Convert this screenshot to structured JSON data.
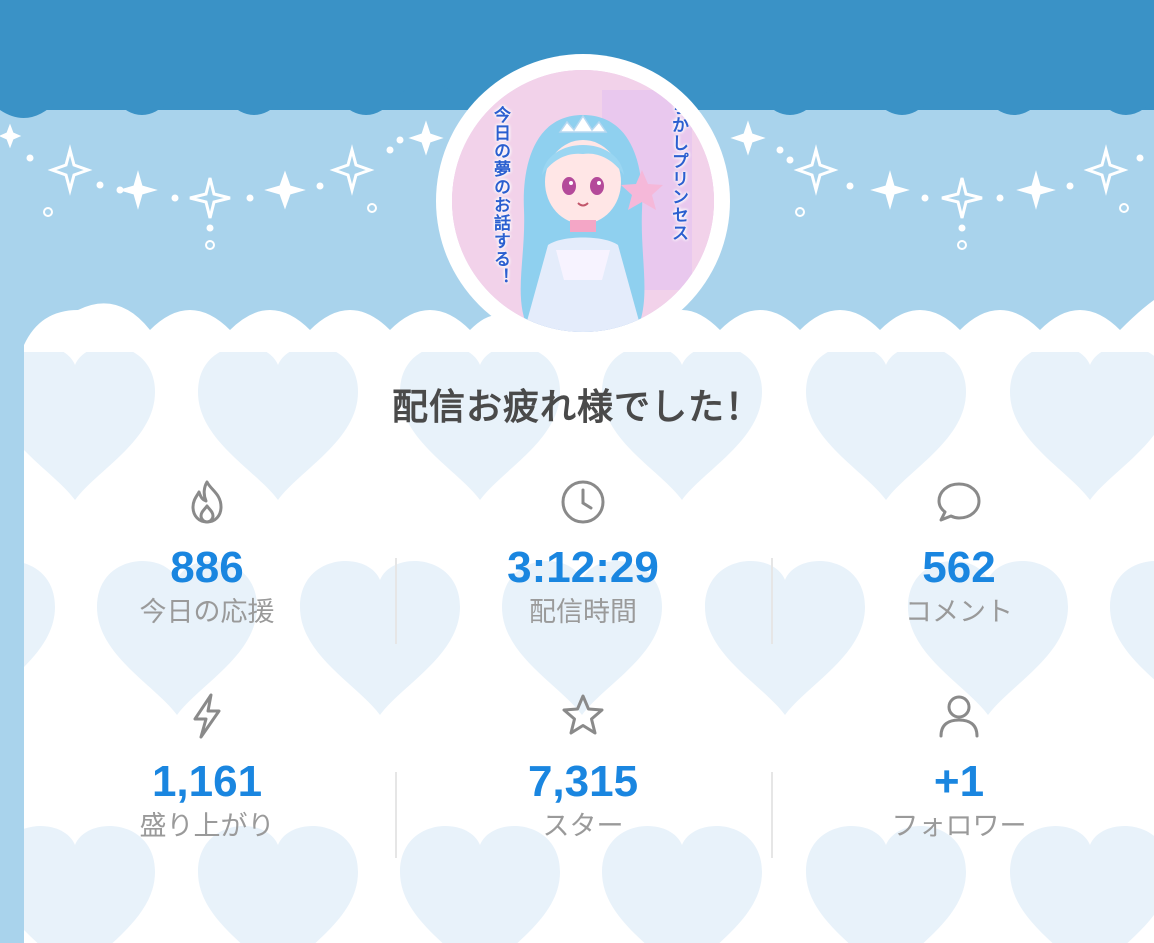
{
  "header": {
    "colors": {
      "top_band": "#3a92c6",
      "light_band": "#a9d3ec",
      "card": "#ffffff",
      "heart": "#e8f2fa"
    }
  },
  "avatar": {
    "text_right": "らかしプリンセス",
    "text_left": "今日の夢のお話する！"
  },
  "headline": "配信お疲れ様でした！",
  "stats": [
    {
      "icon": "flame-icon",
      "value": "886",
      "label": "今日の応援"
    },
    {
      "icon": "clock-icon",
      "value": "3:12:29",
      "label": "配信時間"
    },
    {
      "icon": "comment-icon",
      "value": "562",
      "label": "コメント"
    },
    {
      "icon": "lightning-icon",
      "value": "1,161",
      "label": "盛り上がり"
    },
    {
      "icon": "star-icon",
      "value": "7,315",
      "label": "スター"
    },
    {
      "icon": "person-icon",
      "value": "+1",
      "label": "フォロワー"
    }
  ],
  "accent_color": "#1a86e0",
  "label_color": "#9a9a9a"
}
